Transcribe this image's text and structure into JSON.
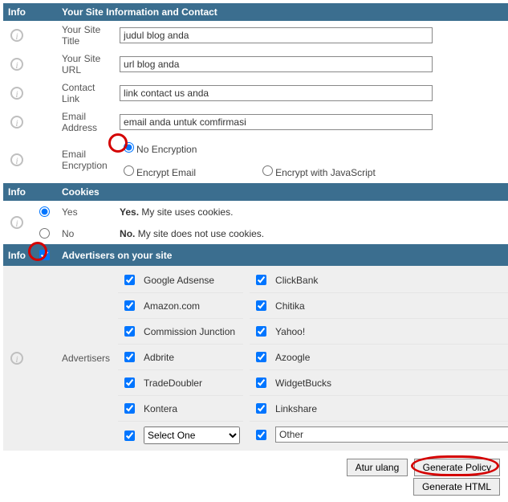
{
  "sections": {
    "info_label": "Info",
    "site_info_header": "Your Site Information and Contact",
    "cookies_header": "Cookies",
    "advertisers_header": "Advertisers on your site"
  },
  "site": {
    "title_label": "Your Site Title",
    "title_value": "judul blog anda",
    "url_label": "Your Site URL",
    "url_value": "url blog anda",
    "contact_label": "Contact Link",
    "contact_value": "link contact us anda",
    "email_label": "Email Address",
    "email_value": "email anda untuk comfirmasi",
    "encryption_label": "Email Encryption",
    "enc_none": "No Encryption",
    "enc_encrypt": "Encrypt Email",
    "enc_js": "Encrypt with JavaScript"
  },
  "cookies": {
    "yes_label": "Yes",
    "yes_desc_bold": "Yes.",
    "yes_desc_rest": " My site uses cookies.",
    "no_label": "No",
    "no_desc_bold": "No.",
    "no_desc_rest": " My site does not use cookies."
  },
  "advertisers": {
    "label": "Advertisers",
    "left": [
      "Google Adsense",
      "Amazon.com",
      "Commission Junction",
      "Adbrite",
      "TradeDoubler",
      "Kontera"
    ],
    "right": [
      "ClickBank",
      "Chitika",
      "Yahoo!",
      "Azoogle",
      "WidgetBucks",
      "Linkshare"
    ],
    "select_one": "Select One",
    "other_value": "Other"
  },
  "buttons": {
    "reset": "Atur ulang",
    "generate_policy": "Generate Policy",
    "generate_html": "Generate HTML"
  }
}
